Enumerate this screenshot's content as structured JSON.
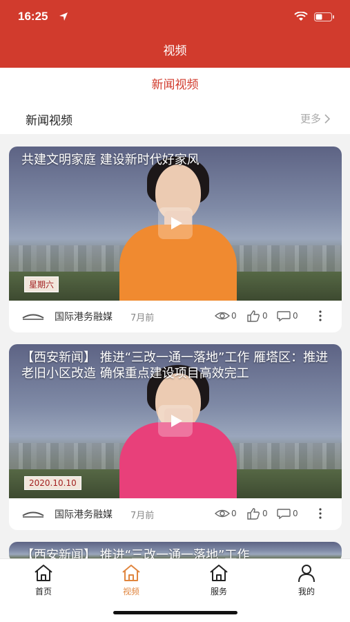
{
  "status": {
    "time": "16:25"
  },
  "navbar": {
    "title": "视频"
  },
  "subtab": {
    "label": "新闻视频"
  },
  "section": {
    "title": "新闻视频",
    "more": "更多"
  },
  "cards": [
    {
      "headline": "共建文明家庭 建设新时代好家风",
      "tag": "星期六",
      "source": "国际港务融媒",
      "time": "7月前",
      "views": "0",
      "likes": "0",
      "comments": "0",
      "outfit_color": "#f08a30"
    },
    {
      "headline": "【西安新闻】 推进“三改一通一落地”工作 雁塔区：推进老旧小区改造 确保重点建设项目高效完工",
      "tag": "2020.10.10",
      "source": "国际港务融媒",
      "time": "7月前",
      "views": "0",
      "likes": "0",
      "comments": "0",
      "outfit_color": "#e8407a"
    },
    {
      "headline": "【西安新闻】 推进“三改一通一落地”工作"
    }
  ],
  "tabbar": [
    {
      "label": "首页",
      "icon": "home-icon"
    },
    {
      "label": "视频",
      "icon": "video-home-icon",
      "active": true
    },
    {
      "label": "服务",
      "icon": "service-home-icon"
    },
    {
      "label": "我的",
      "icon": "user-icon"
    }
  ],
  "colors": {
    "brand_red": "#d13b2d",
    "active_tab": "#e0853e"
  }
}
